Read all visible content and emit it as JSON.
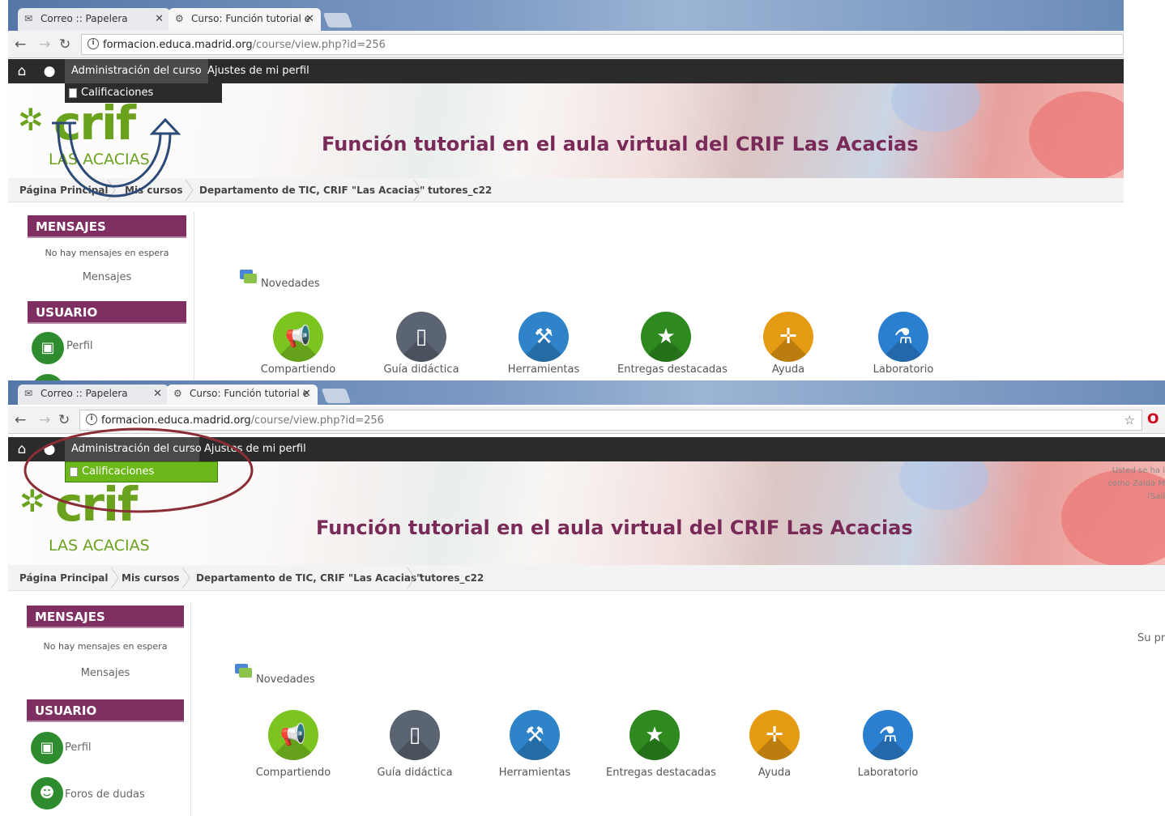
{
  "browser": {
    "tabs": [
      {
        "title": "Correo :: Papelera",
        "icon": "mail-icon"
      },
      {
        "title": "Curso: Función tutorial e",
        "icon": "moodle-icon"
      }
    ],
    "url_host": "formacion.educa.madrid.org",
    "url_path": "/course/view.php?id=256"
  },
  "nav": {
    "course_admin": "Administración del curso",
    "profile_settings": "Ajustes de mi perfil",
    "dropdown_item": "Calificaciones"
  },
  "banner": {
    "title": "Función tutorial en el aula virtual del CRIF Las Acacias",
    "logo_main": "crif",
    "logo_sub": "LAS ACACIAS"
  },
  "breadcrumb": [
    "Página Principal",
    "Mis cursos",
    "Departamento de TIC, CRIF \"Las Acacias\"",
    "tutores_c22"
  ],
  "sidebar": {
    "messages_title": "MENSAJES",
    "no_messages": "No hay mensajes en espera",
    "messages_link": "Mensajes",
    "user_title": "USUARIO",
    "profile": "Perfil",
    "forums": "Foros de dudas"
  },
  "main": {
    "news": "Novedades",
    "activities": [
      {
        "label": "Compartiendo",
        "icon": "megaphone-icon",
        "color": "#7cc520"
      },
      {
        "label": "Guía didáctica",
        "icon": "notebook-icon",
        "color": "#5a6472"
      },
      {
        "label": "Herramientas",
        "icon": "tools-icon",
        "color": "#2f84c9"
      },
      {
        "label": "Entregas destacadas",
        "icon": "star-icon",
        "color": "#2e8a1f"
      },
      {
        "label": "Ayuda",
        "icon": "help-icon",
        "color": "#e49a12"
      },
      {
        "label": "Laboratorio",
        "icon": "flask-icon",
        "color": "#2b7fd0"
      }
    ]
  },
  "login_info": {
    "line1": "Usted se ha i",
    "line2": "como Zaida M",
    "line3": "(Sali"
  },
  "right_note": "Su pro",
  "colors": {
    "block_header": "#7f2e62",
    "topnav": "#2b2b2b",
    "dropdown_dark": "#2b2b2b",
    "dropdown_green": "#6cb81a",
    "annotation_arrow": "#2c4a78",
    "annotation_ellipse": "#8a2d35"
  }
}
